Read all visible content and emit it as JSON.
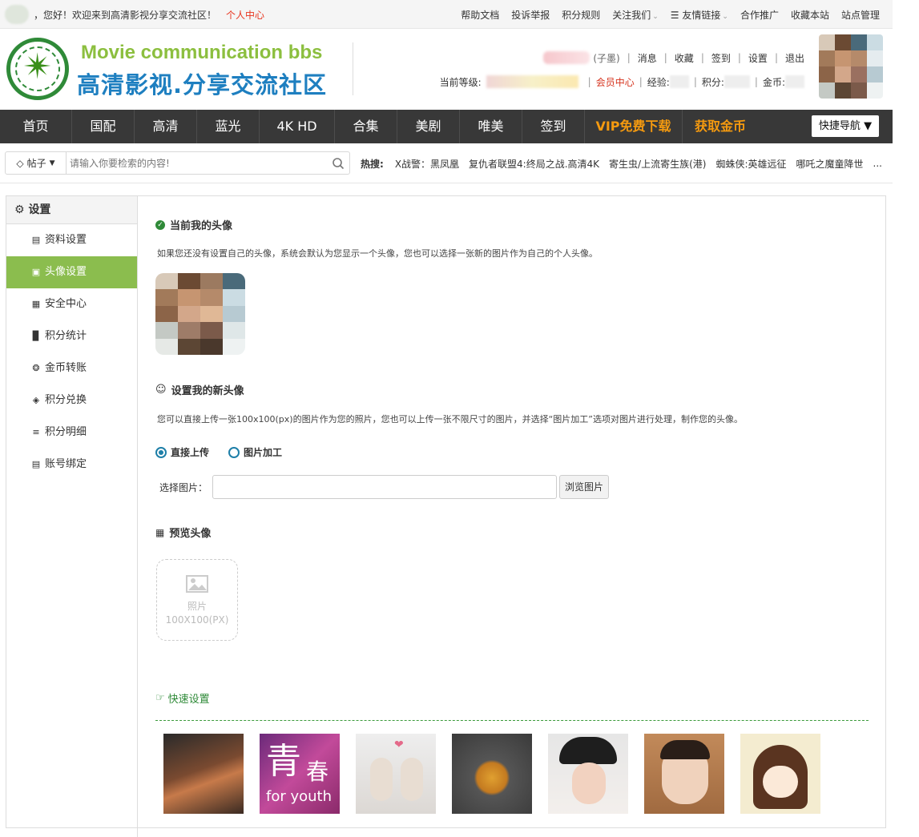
{
  "topbar": {
    "greeting": "，您好！欢迎来到高清影视分享交流社区！",
    "personal_center": "个人中心",
    "links": [
      "帮助文档",
      "投诉举报",
      "积分规则",
      "关注我们",
      "友情链接",
      "合作推广",
      "收藏本站",
      "站点管理"
    ]
  },
  "header": {
    "logo_en": "Movie communication bbs",
    "logo_cn": "高清影视.分享交流社区",
    "user_group": "(子墨)",
    "user_links": [
      "消息",
      "收藏",
      "签到",
      "设置",
      "退出"
    ],
    "level_label": "当前等级:",
    "vip_center": "会员中心",
    "exp_label": "经验:",
    "points_label": "积分:",
    "coin_label": "金币:"
  },
  "nav": {
    "items": [
      "首页",
      "国配",
      "高清",
      "蓝光",
      "4K HD",
      "合集",
      "美剧",
      "唯美",
      "签到"
    ],
    "gold_items": [
      "VIP免费下载",
      "获取金币"
    ],
    "quick_nav": "快捷导航"
  },
  "search": {
    "type": "帖子",
    "placeholder": "请输入你要检索的内容!",
    "hot_label": "热搜:",
    "hot_keywords": [
      "X战警：黑凤凰",
      "复仇者联盟4:终局之战.高清4K",
      "寄生虫/上流寄生族(港)",
      "蜘蛛侠:英雄远征",
      "哪吒之魔童降世",
      "..."
    ]
  },
  "sidebar": {
    "title": "设置",
    "items": [
      {
        "label": "资料设置",
        "icon": "card-icon"
      },
      {
        "label": "头像设置",
        "icon": "image-icon"
      },
      {
        "label": "安全中心",
        "icon": "id-card-icon"
      },
      {
        "label": "积分统计",
        "icon": "bar-chart-icon"
      },
      {
        "label": "金币转账",
        "icon": "coin-icon"
      },
      {
        "label": "积分兑换",
        "icon": "diamond-icon"
      },
      {
        "label": "积分明细",
        "icon": "list-icon"
      },
      {
        "label": "账号绑定",
        "icon": "card-icon"
      }
    ],
    "active_index": 1
  },
  "main": {
    "current_title": "当前我的头像",
    "current_desc": "如果您还没有设置自己的头像，系统会默认为您显示一个头像，您也可以选择一张新的图片作为自己的个人头像。",
    "new_title": "设置我的新头像",
    "new_desc": "您可以直接上传一张100x100(px)的图片作为您的照片，您也可以上传一张不限尺寸的图片，并选择“图片加工”选项对图片进行处理，制作您的头像。",
    "radio_direct": "直接上传",
    "radio_process": "图片加工",
    "choose_label": "选择图片：",
    "browse_label": "浏览图片",
    "preview_title": "预览头像",
    "preview_photo": "照片",
    "preview_size": "100X100(PX)",
    "quick_title": "快速设置"
  },
  "presets": {
    "thumb2_big": "青",
    "thumb2_small": "春",
    "thumb2_caption": "for youth"
  },
  "colors": {
    "nav_bg": "#383838",
    "accent_green": "#8bbd4e",
    "gold": "#f59a0f",
    "link_red": "#e8341e",
    "radio_blue": "#1e7fa8"
  }
}
